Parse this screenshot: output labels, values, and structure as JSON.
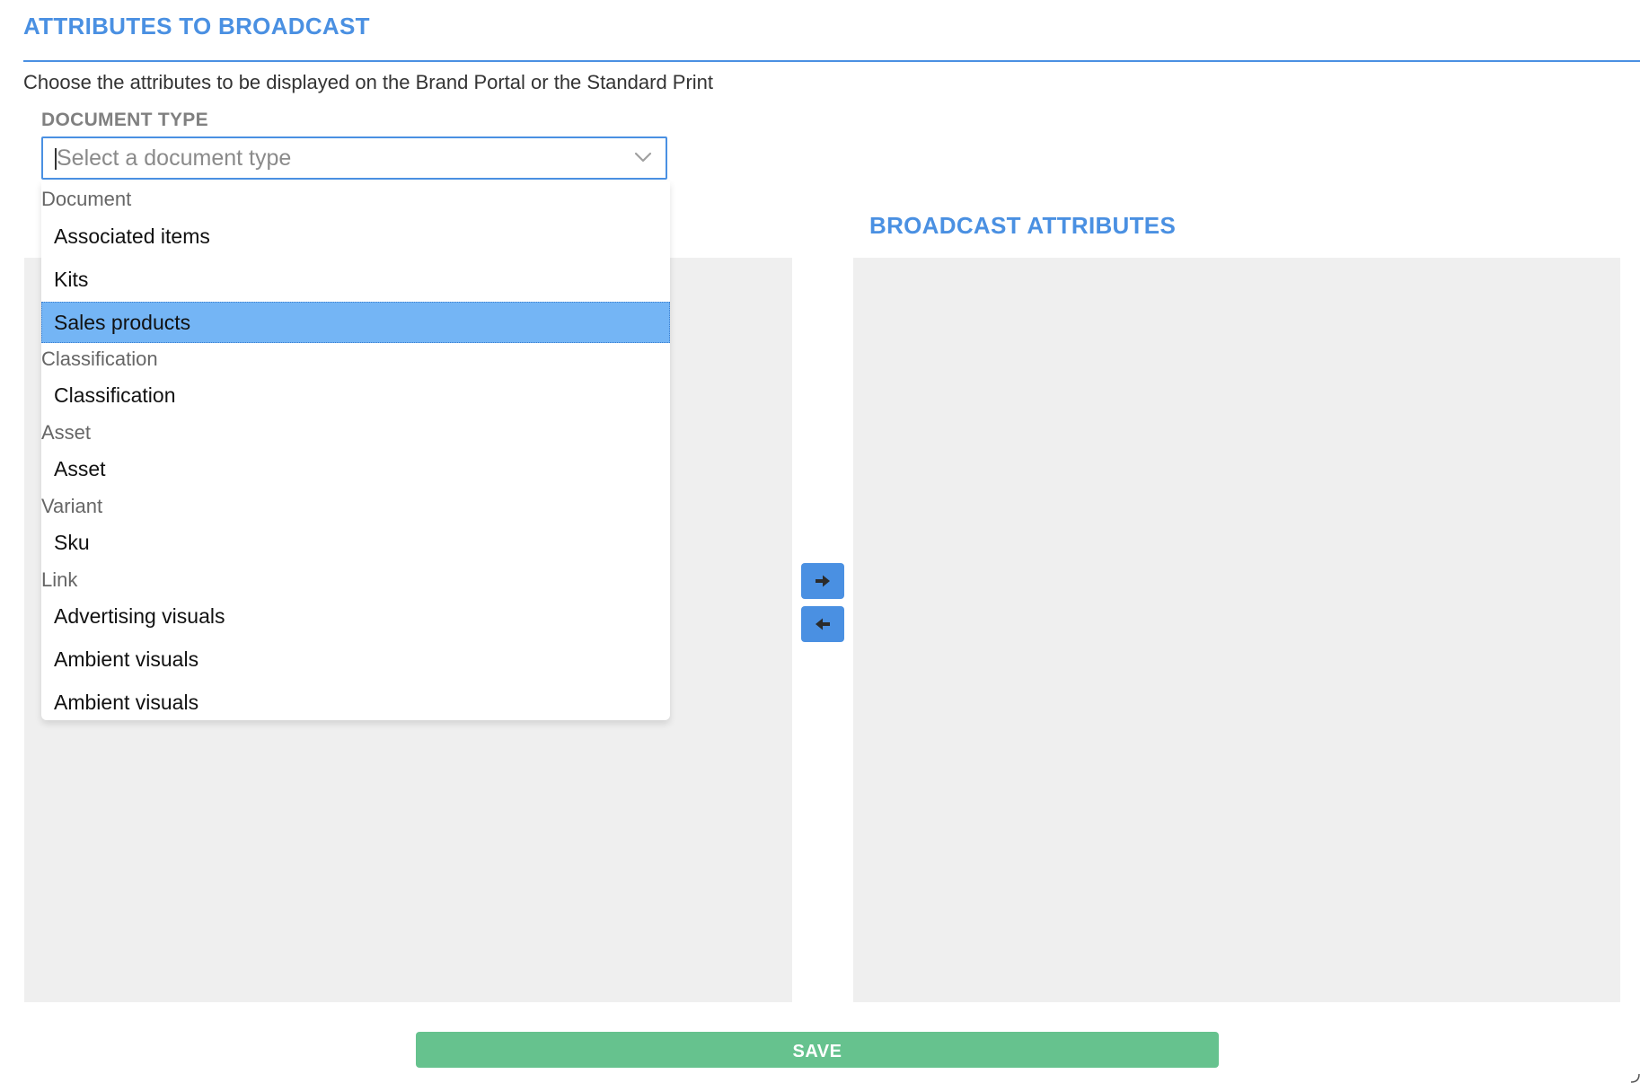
{
  "section": {
    "title": "ATTRIBUTES TO BROADCAST",
    "description": "Choose the attributes to be displayed on the Brand Portal or the Standard Print"
  },
  "document_type": {
    "label": "DOCUMENT TYPE",
    "placeholder": "Select a document type",
    "value": ""
  },
  "dropdown": {
    "groups": [
      {
        "label": "Document",
        "options": [
          "Associated items",
          "Kits",
          "Sales products"
        ]
      },
      {
        "label": "Classification",
        "options": [
          "Classification"
        ]
      },
      {
        "label": "Asset",
        "options": [
          "Asset"
        ]
      },
      {
        "label": "Variant",
        "options": [
          "Sku"
        ]
      },
      {
        "label": "Link",
        "options": [
          "Advertising visuals",
          "Ambient visuals",
          "Ambient visuals"
        ]
      }
    ],
    "highlighted": "Sales products"
  },
  "broadcast": {
    "title": "BROADCAST ATTRIBUTES"
  },
  "buttons": {
    "move_right_icon": "arrow-right-icon",
    "move_left_icon": "arrow-left-icon",
    "save_label": "SAVE"
  },
  "colors": {
    "accent": "#4a90e2",
    "save": "#66c28e",
    "highlight": "#74b5f5",
    "panel": "#efefef"
  }
}
